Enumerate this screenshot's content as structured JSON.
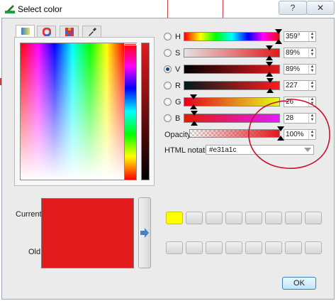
{
  "window": {
    "title": "Select color",
    "help_label": "?",
    "close_label": "✕"
  },
  "tabs": [
    {
      "name": "color-ramp-tab",
      "icon": "color-ramp-icon",
      "active": true
    },
    {
      "name": "color-wheel-tab",
      "icon": "color-wheel-icon",
      "active": false
    },
    {
      "name": "palette-tab",
      "icon": "palette-grid-icon",
      "active": false
    },
    {
      "name": "color-sampler-tab",
      "icon": "eyedropper-icon",
      "active": false
    }
  ],
  "channels": [
    {
      "key": "H",
      "value": "359°",
      "selected": false
    },
    {
      "key": "S",
      "value": "89%",
      "selected": false
    },
    {
      "key": "V",
      "value": "89%",
      "selected": true
    },
    {
      "key": "R",
      "value": "227",
      "selected": false
    },
    {
      "key": "G",
      "value": "26",
      "selected": false
    },
    {
      "key": "B",
      "value": "28",
      "selected": false
    }
  ],
  "opacity": {
    "label": "Opacity",
    "value": "100%"
  },
  "html_notation": {
    "label": "HTML notation",
    "value": "#e31a1c"
  },
  "preview": {
    "current_label": "Current",
    "old_label": "Old",
    "current_color": "#e31a1c",
    "old_color": "#e31a1c"
  },
  "color_slots_row1": [
    "#ffff00",
    "",
    "",
    "",
    "",
    "",
    "",
    ""
  ],
  "ok_label": "OK",
  "colors": {
    "accent": "#e31a1c",
    "annotation": "#c8102e"
  }
}
